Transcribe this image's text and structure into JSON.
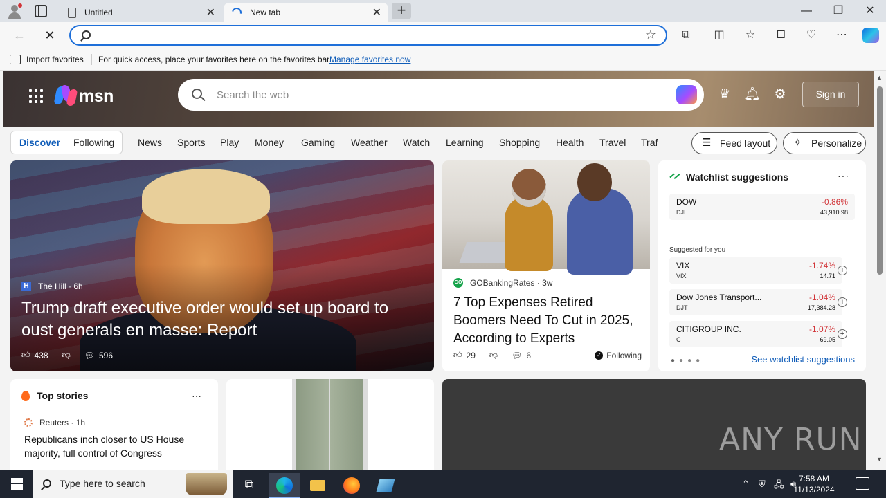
{
  "browser": {
    "tabs": [
      {
        "title": "Untitled",
        "active": false
      },
      {
        "title": "New tab",
        "active": true
      }
    ],
    "address": {
      "value": "",
      "placeholder": ""
    },
    "favorites_bar": {
      "import_label": "Import favorites",
      "message": "For quick access, place your favorites here on the favorites bar.",
      "manage_link": "Manage favorites now"
    }
  },
  "msn": {
    "logo_text": "msn",
    "search_placeholder": "Search the web",
    "sign_in": "Sign in",
    "feed_tabs": [
      {
        "label": "Discover",
        "selected": true
      },
      {
        "label": "Following",
        "selected": false
      }
    ],
    "nav_links": [
      "News",
      "Sports",
      "Play",
      "Money",
      "Gaming",
      "Weather",
      "Watch",
      "Learning",
      "Shopping",
      "Health",
      "Travel",
      "Traf"
    ],
    "feed_layout_label": "Feed layout",
    "personalize_label": "Personalize"
  },
  "hero": {
    "source": "The Hill",
    "source_logo": "H",
    "age": "6h",
    "title": "Trump draft executive order would set up board to oust generals en masse: Report",
    "likes": "438",
    "comments": "596"
  },
  "article2": {
    "source": "GOBankingRates",
    "source_logo": "GO",
    "age": "3w",
    "title": "7 Top Expenses Retired Boomers Need To Cut in 2025, According to Experts",
    "likes": "29",
    "comments": "6",
    "follow_label": "Following"
  },
  "watchlist": {
    "title": "Watchlist suggestions",
    "main": {
      "name": "DOW",
      "symbol": "DJI",
      "change": "-0.86%",
      "price": "43,910.98"
    },
    "suggested_label": "Suggested for you",
    "suggested": [
      {
        "name": "VIX",
        "symbol": "VIX",
        "change": "-1.74%",
        "price": "14.71"
      },
      {
        "name": "Dow Jones Transport...",
        "symbol": "DJT",
        "change": "-1.04%",
        "price": "17,384.28"
      },
      {
        "name": "CITIGROUP INC.",
        "symbol": "C",
        "change": "-1.07%",
        "price": "69.05"
      }
    ],
    "see_link": "See watchlist suggestions"
  },
  "top_stories": {
    "title": "Top stories",
    "source": "Reuters",
    "age": "1h",
    "headline": "Republicans inch closer to US House majority, full control of Congress"
  },
  "watermark": "ANY RUN",
  "taskbar": {
    "search_placeholder": "Type here to search",
    "time": "7:58 AM",
    "date": "11/13/2024"
  },
  "colors": {
    "accent": "#1e6fd9",
    "link": "#0f5cb8",
    "negative": "#d13438",
    "taskbar": "#1f2530"
  }
}
